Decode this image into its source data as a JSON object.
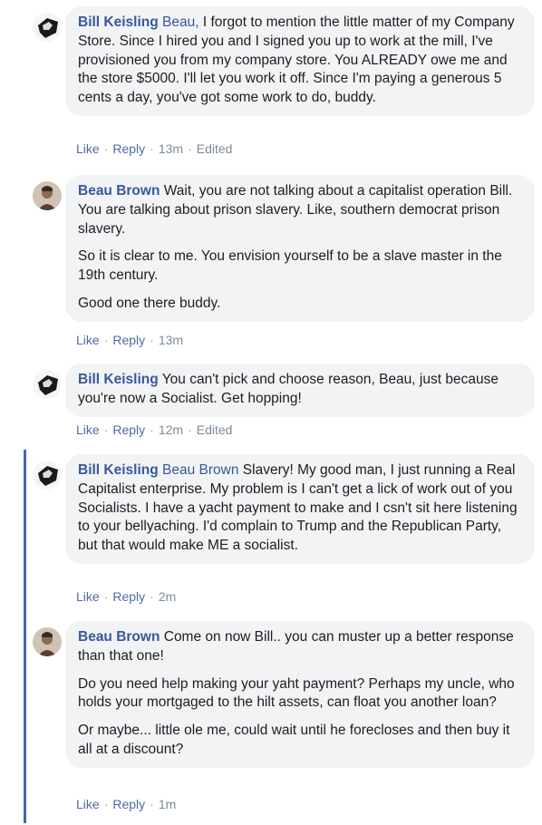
{
  "comments": [
    {
      "author": "Bill Keisling",
      "mention": "Beau,",
      "text": " I forgot to mention the little matter of my Company Store. Since I hired you and I signed you up to work at the mill, I've provisioned you from my company store. You ALREADY owe me and the store $5000. I'll let you work it off. Since I'm paying a generous 5 cents a day, you've got some work to do, buddy.",
      "like": "Like",
      "reply": "Reply",
      "time": "13m",
      "edited": "Edited"
    },
    {
      "author": "Beau Brown",
      "text": " Wait, you are not talking about a capitalist operation Bill. You are talking about prison slavery. Like, southern democrat prison slavery.",
      "para2": "So it is clear to me. You envision yourself to be a slave master in the 19th century.",
      "para3": "Good one there buddy.",
      "like": "Like",
      "reply": "Reply",
      "time": "13m"
    },
    {
      "author": "Bill Keisling",
      "text": " You can't pick and choose reason, Beau, just because you're now a Socialist. Get hopping!",
      "like": "Like",
      "reply": "Reply",
      "time": "12m",
      "edited": "Edited"
    },
    {
      "author": "Bill Keisling",
      "mention": "Beau Brown",
      "text": " Slavery! My good man, I just running a Real Capitalist enterprise. My problem is I can't get a lick of work out of you Socialists. I have a yacht payment to make and I csn't sit here listening to your bellyaching. I'd complain to Trump and the Republican Party, but that would make ME a socialist.",
      "like": "Like",
      "reply": "Reply",
      "time": "2m"
    },
    {
      "author": "Beau Brown",
      "text": " Come on now Bill.. you can muster up a better response than that one!",
      "para2": "Do you need help making your yaht payment? Perhaps my uncle, who holds your mortgaged to the hilt assets, can float you another loan?",
      "para3": "Or maybe... little ole me, could wait until he forecloses and then buy it all at a discount?",
      "like": "Like",
      "reply": "Reply",
      "time": "1m"
    }
  ],
  "colors": {
    "author": "#385898",
    "bubble": "#f2f3f5",
    "meta": "#7c8a99",
    "thread_line": "#4267b2"
  },
  "icons": {
    "bill_avatar": "profile-photo",
    "beau_avatar": "profile-photo"
  }
}
